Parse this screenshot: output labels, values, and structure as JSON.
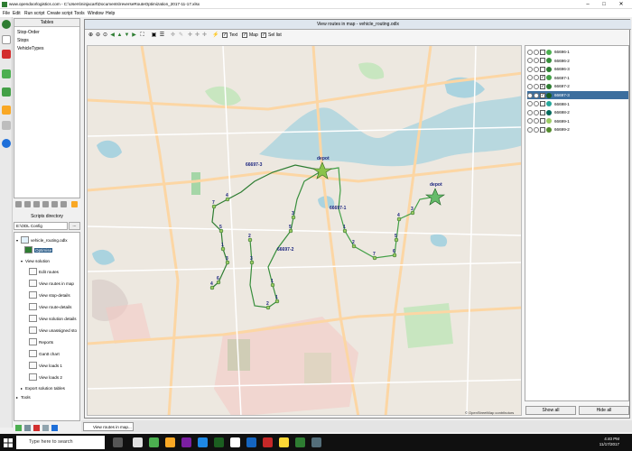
{
  "window": {
    "title": "www.opendoorlogistics.com - C:\\Users\\ninjacart\\Documents\\reverseRouteOptimization_2017-11-17.xlsx"
  },
  "menu": [
    "File",
    "Edit",
    "Run script",
    "Create script",
    "Tools",
    "Window",
    "Help"
  ],
  "tables_panel": {
    "header": "Tables",
    "items": [
      "Stop-Order",
      "Stops",
      "VehicleTypes"
    ]
  },
  "scripts": {
    "header": "Scripts directory",
    "path": "E:\\ODL Config",
    "browse_label": "...",
    "tree": {
      "root": "vehicle_routing.odlx",
      "optimise": "Optimise",
      "view_solution": "View solution",
      "children": [
        "Edit routes",
        "View routes in map",
        "View stop-details",
        "View route-details",
        "View solution details",
        "View unassigned sto",
        "Reports",
        "Gantt chart",
        "View loads 1",
        "View loads 2"
      ],
      "export": "Export solution tables",
      "tools": "Tools"
    }
  },
  "map_window": {
    "title": "View routes in map - vehicle_routing.odlx",
    "toolbar": {
      "text_label": "Text",
      "map_label": "Map",
      "sel_label": "Sel list"
    },
    "map": {
      "labels": {
        "route_a": "66697-3",
        "route_b": "66697-2",
        "route_c": "66697-1",
        "depot_a": "depot",
        "depot_b": "depot",
        "stop_nums": [
          "7",
          "5",
          "1",
          "3",
          "6",
          "4",
          "4",
          "5",
          "3",
          "2",
          "1",
          "1",
          "2",
          "3",
          "6",
          "5",
          "4",
          "3",
          "7",
          "2",
          "1"
        ]
      },
      "attribution": "© OpenStreetMap contributors"
    },
    "legend": {
      "rows": [
        {
          "label": "66696-1",
          "color": "#4caf50",
          "checked": false,
          "selected": false
        },
        {
          "label": "66696-2",
          "color": "#388e3c",
          "checked": false,
          "selected": false
        },
        {
          "label": "66696-3",
          "color": "#2e7d32",
          "checked": false,
          "selected": false
        },
        {
          "label": "66697-1",
          "color": "#43a047",
          "checked": true,
          "selected": false
        },
        {
          "label": "66697-2",
          "color": "#2e7d32",
          "checked": true,
          "selected": false
        },
        {
          "label": "66697-3",
          "color": "#1b5e20",
          "checked": true,
          "selected": true
        },
        {
          "label": "66698-1",
          "color": "#26a69a",
          "checked": false,
          "selected": false
        },
        {
          "label": "66698-2",
          "color": "#00695c",
          "checked": false,
          "selected": false
        },
        {
          "label": "66699-1",
          "color": "#9ccc65",
          "checked": false,
          "selected": false
        },
        {
          "label": "66699-2",
          "color": "#558b2f",
          "checked": false,
          "selected": false
        }
      ],
      "show_all": "Show all",
      "hide_all": "Hide all"
    }
  },
  "tabs": {
    "map_tab": "View routes in map..."
  },
  "taskbar": {
    "search_placeholder": "Type here to search",
    "time": "4:40 PM",
    "date": "11/17/2017"
  }
}
